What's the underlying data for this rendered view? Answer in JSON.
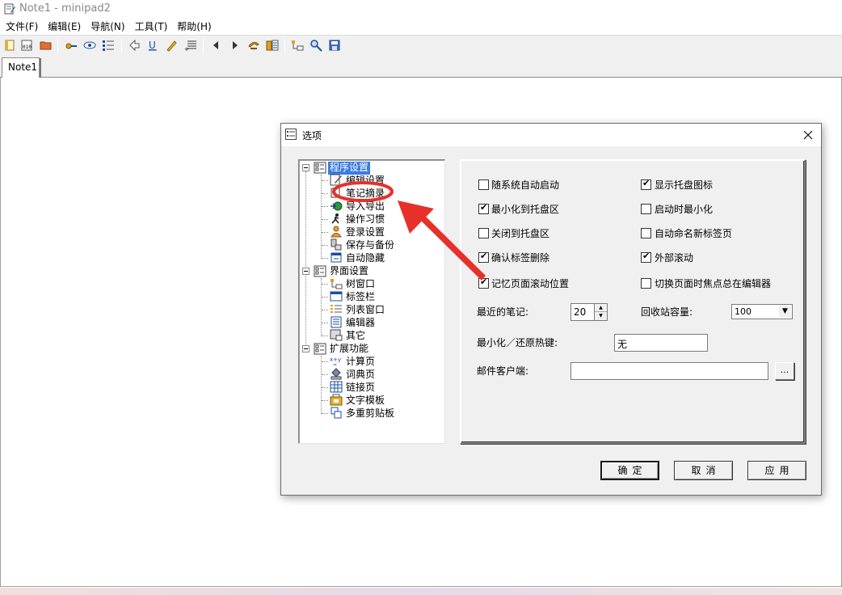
{
  "window": {
    "title": "Note1 - minipad2"
  },
  "menu": [
    "文件(F)",
    "编辑(E)",
    "导航(N)",
    "工具(T)",
    "帮助(H)"
  ],
  "toolbar": {
    "buttons": [
      "new-note-icon",
      "new-calc-icon",
      "open-folder-icon",
      "link-icon",
      "view-icon",
      "list-icon",
      "back-arrow-icon",
      "underline-icon",
      "highlight-icon",
      "numbered-list-icon",
      "prev-icon",
      "next-icon",
      "sync-icon",
      "pages-icon",
      "tree-icon",
      "search-icon",
      "save-icon"
    ]
  },
  "tabs": [
    "Note1"
  ],
  "dialog": {
    "title": "选项",
    "tree": [
      {
        "label": "程序设置",
        "children": [
          "编辑设置",
          "笔记摘录",
          "导入导出",
          "操作习惯",
          "登录设置",
          "保存与备份",
          "自动隐藏"
        ]
      },
      {
        "label": "界面设置",
        "children": [
          "树窗口",
          "标签栏",
          "列表窗口",
          "编辑器",
          "其它"
        ]
      },
      {
        "label": "扩展功能",
        "children": [
          "计算页",
          "词典页",
          "链接页",
          "文字模板",
          "多重剪贴板"
        ]
      }
    ],
    "selected": "程序设置",
    "checkboxes": [
      {
        "label": "随系统自动启动",
        "checked": false
      },
      {
        "label": "显示托盘图标",
        "checked": true
      },
      {
        "label": "最小化到托盘区",
        "checked": true
      },
      {
        "label": "启动时最小化",
        "checked": false
      },
      {
        "label": "关闭到托盘区",
        "checked": false
      },
      {
        "label": "自动命名新标签页",
        "checked": false
      },
      {
        "label": "确认标签删除",
        "checked": true
      },
      {
        "label": "外部滚动",
        "checked": true
      },
      {
        "label": "记忆页面滚动位置",
        "checked": true
      },
      {
        "label": "切换页面时焦点总在编辑器",
        "checked": false
      }
    ],
    "fields": {
      "recent_notes_label": "最近的笔记:",
      "recent_notes_value": "20",
      "recycle_label": "回收站容量:",
      "recycle_value": "100",
      "hotkey_label": "最小化／还原热键:",
      "hotkey_value": "无",
      "mail_label": "邮件客户端:",
      "mail_value": "",
      "browse_label": "..."
    },
    "buttons": {
      "ok": "确定",
      "cancel": "取消",
      "apply": "应用"
    }
  },
  "colors": {
    "selection": "#3a7be0",
    "annotation": "#e8302a"
  }
}
